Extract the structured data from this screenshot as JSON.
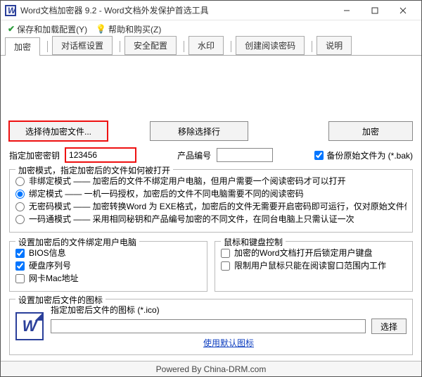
{
  "titlebar": {
    "title": "Word文档加密器 9.2 - Word文档外发保护首选工具"
  },
  "menubar": {
    "save": "保存和加载配置(Y)",
    "help": "帮助和购买(Z)"
  },
  "tabs": [
    "加密",
    "对话框设置",
    "安全配置",
    "水印",
    "创建阅读密码",
    "说明"
  ],
  "actions": {
    "select_file": "选择待加密文件...",
    "remove_row": "移除选择行",
    "encrypt": "加密"
  },
  "keyrow": {
    "key_label": "指定加密密钥",
    "key_value": "123456",
    "product_label": "产品编号",
    "product_value": "",
    "backup_label": "备份原始文件为 (*.bak)",
    "backup_checked": true
  },
  "mode_group": {
    "legend": "加密模式，指定加密后的文件如何被打开",
    "options": [
      "非绑定模式 —— 加密后的文件不绑定用户电脑，但用户需要一个阅读密码才可以打开",
      "绑定模式 —— 一机一码授权，加密后的文件不同电脑需要不同的阅读密码",
      "无密码模式 —— 加密转换Word 为 EXE格式，加密后的文件无需要开启密码即可运行，仅对原始文件做加密保护",
      "一码通模式 —— 采用相同秘钥和产品编号加密的不同文件，在同台电脑上只需认证一次"
    ],
    "selected": 1
  },
  "bind_group": {
    "legend": "设置加密后的文件绑定用户电脑",
    "bios": {
      "label": "BIOS信息",
      "checked": true
    },
    "hd": {
      "label": "硬盘序列号",
      "checked": true
    },
    "mac": {
      "label": "网卡Mac地址",
      "checked": false
    }
  },
  "mouse_group": {
    "legend": "鼠标和键盘控制",
    "lock_kb": {
      "label": "加密的Word文档打开后锁定用户键盘",
      "checked": false
    },
    "restrict_mouse": {
      "label": "限制用户鼠标只能在阅读窗口范围内工作",
      "checked": false
    }
  },
  "icon_group": {
    "legend": "设置加密后文件的图标",
    "path_label": "指定加密后文件的图标 (*.ico)",
    "path_value": "",
    "browse": "选择",
    "default_link": "使用默认图标"
  },
  "statusbar": {
    "text": "Powered By China-DRM.com"
  }
}
